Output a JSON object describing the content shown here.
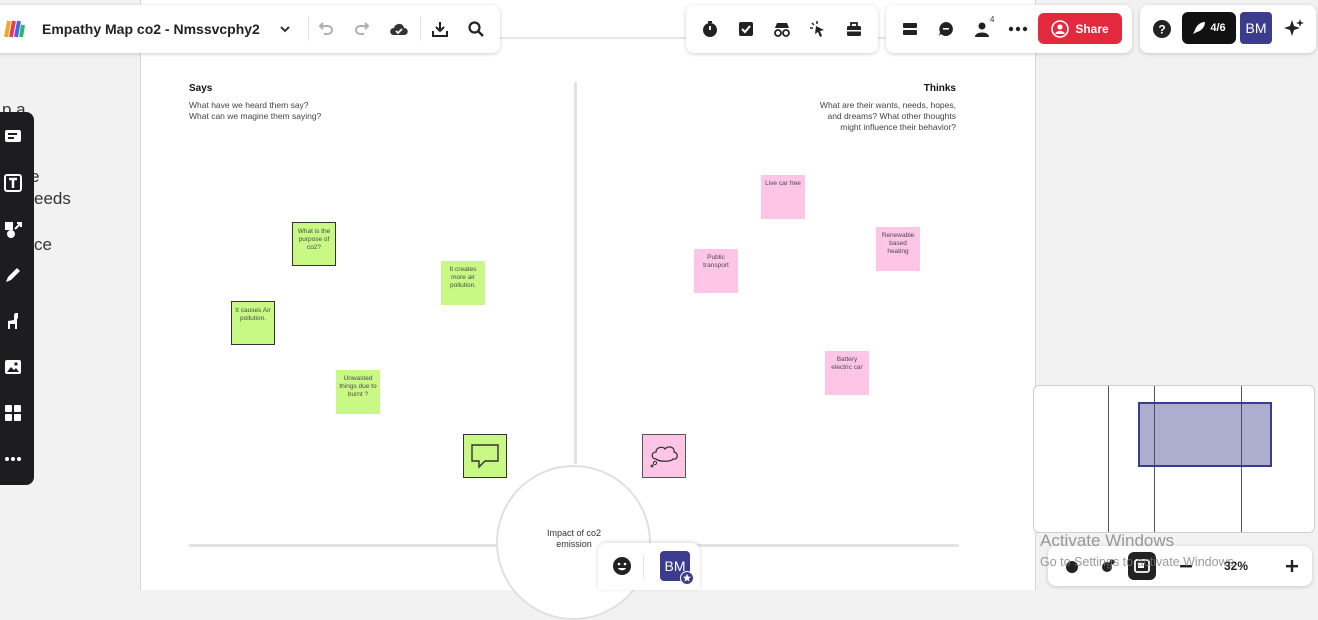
{
  "header": {
    "title": "Empathy Map co2 - Nmssvcphy2"
  },
  "top_right": {
    "collaborator_count": "4",
    "share_label": "Share",
    "progress_label": "4/6",
    "avatar_initials": "BM"
  },
  "board": {
    "says": {
      "title": "Says",
      "desc_line1": "What have we heard them say?",
      "desc_line2": "What can we magine them saying?"
    },
    "thinks": {
      "title": "Thinks",
      "desc_line1": "What are their wants, needs, hopes,",
      "desc_line2": "and dreams? What other thoughts",
      "desc_line3": "might influence their behavior?"
    },
    "center_label": "Impact of co2 emission",
    "green_stickies": [
      "What is the purpose of co2?",
      "It creates more air pollution.",
      "It causes Air pollution.",
      "Unwasted things due to burnt ?"
    ],
    "pink_stickies": [
      "Live car free",
      "Renewable based heating",
      "Public transport",
      "Battery electric car"
    ]
  },
  "left_bleed": {
    "line1": "p a",
    "line2": "e",
    "line3": "eeds",
    "line4": "ce"
  },
  "bottom": {
    "avatar_initials": "BM"
  },
  "zoom": {
    "level": "32%"
  },
  "watermark": {
    "title": "Activate Windows",
    "subtitle": "Go to Settings to activate Windows."
  },
  "colors": {
    "sticky_green": "#c9f985",
    "sticky_pink": "#fec5e7",
    "share_red": "#e3293e",
    "avatar_blue": "#3c3c8e"
  }
}
